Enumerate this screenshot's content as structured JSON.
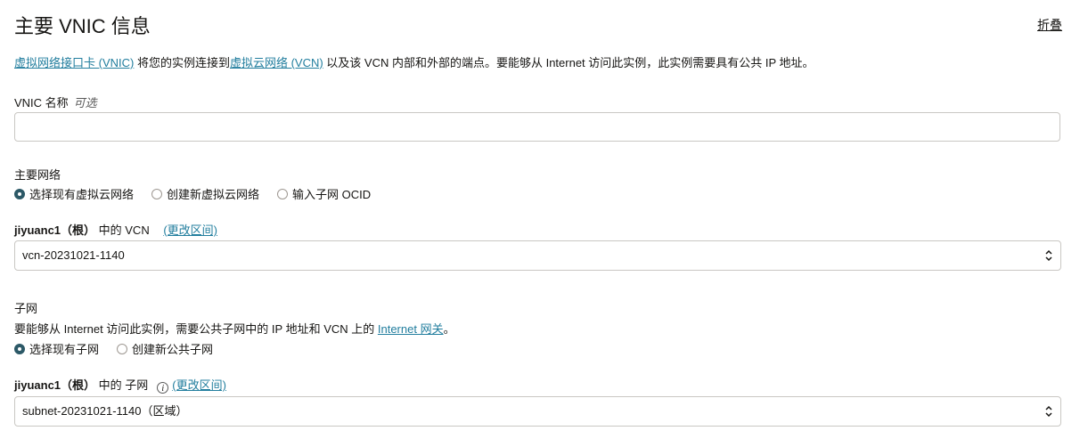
{
  "section": {
    "title": "主要 VNIC 信息",
    "collapse_label": "折叠"
  },
  "description": {
    "link1": "虚拟网络接口卡 (VNIC)",
    "text1": " 将您的实例连接到",
    "link2": "虚拟云网络 (VCN)",
    "text2": " 以及该 VCN 内部和外部的端点。要能够从 Internet 访问此实例，此实例需要具有公共 IP 地址。"
  },
  "vnic_name": {
    "label": "VNIC 名称",
    "optional": "可选",
    "value": ""
  },
  "primary_network": {
    "label": "主要网络",
    "options": [
      "选择现有虚拟云网络",
      "创建新虚拟云网络",
      "输入子网 OCID"
    ],
    "selected_index": 0
  },
  "vcn": {
    "compartment": "jiyuanc1（根）",
    "label_suffix": " 中的 VCN",
    "change_link": "(更改区间)",
    "value": "vcn-20231021-1140"
  },
  "subnet_section": {
    "label": "子网",
    "help_text": "要能够从 Internet 访问此实例，需要公共子网中的 IP 地址和 VCN 上的 ",
    "help_link": "Internet 网关",
    "help_end": "。",
    "options": [
      "选择现有子网",
      "创建新公共子网"
    ],
    "selected_index": 0
  },
  "subnet": {
    "compartment": "jiyuanc1（根）",
    "label_suffix": " 中的 子网",
    "info_icon": "info-icon",
    "change_link": "(更改区间)",
    "value": "subnet-20231021-1140（区域）"
  }
}
